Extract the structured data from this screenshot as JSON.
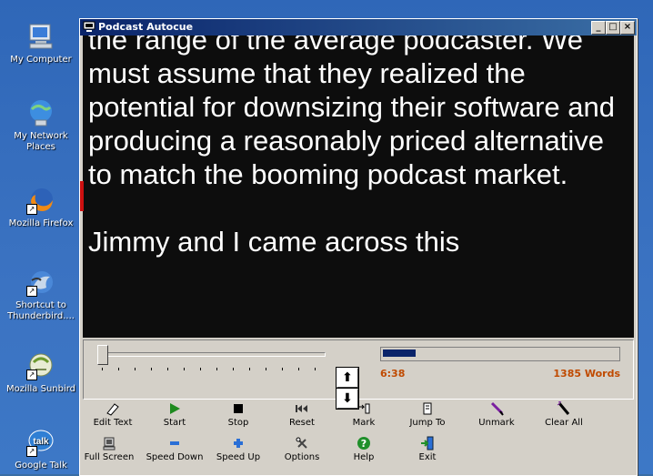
{
  "desktop": {
    "icons": [
      {
        "label": "My Computer",
        "icon": "my-computer-icon"
      },
      {
        "label": "My Network Places",
        "icon": "network-places-icon"
      },
      {
        "label": "Mozilla Firefox",
        "icon": "firefox-icon"
      },
      {
        "label": "Shortcut to Thunderbird....",
        "icon": "thunderbird-icon"
      },
      {
        "label": "Mozilla Sunbird",
        "icon": "sunbird-icon"
      },
      {
        "label": "Google Talk",
        "icon": "google-talk-icon",
        "badge": "talk"
      }
    ]
  },
  "window": {
    "title": "Podcast Autocue",
    "minimize": "_",
    "maximize": "□",
    "close": "×"
  },
  "cue": {
    "paragraph1": "the range of the average podcaster. We must assume that they realized the potential for downsizing their software and producing a reasonably priced alternative to match the booming podcast market.",
    "paragraph2": "Jimmy and I came across this"
  },
  "controls": {
    "scroll_up": "⬆",
    "scroll_down": "⬇",
    "elapsed_time": "6:38",
    "word_count": "1385 Words",
    "progress_fraction": 0.14
  },
  "toolbar": {
    "row1": [
      {
        "label": "Edit Text",
        "icon": "edit-text-icon"
      },
      {
        "label": "Start",
        "icon": "play-icon"
      },
      {
        "label": "Stop",
        "icon": "stop-icon"
      },
      {
        "label": "Reset",
        "icon": "rewind-icon"
      },
      {
        "label": "Mark",
        "icon": "mark-icon"
      },
      {
        "label": "Jump To",
        "icon": "jump-to-icon"
      },
      {
        "label": "Unmark",
        "icon": "unmark-icon"
      },
      {
        "label": "Clear All",
        "icon": "clear-all-icon"
      }
    ],
    "row2": [
      {
        "label": "Full Screen",
        "icon": "full-screen-icon"
      },
      {
        "label": "Speed Down",
        "icon": "minus-icon"
      },
      {
        "label": "Speed Up",
        "icon": "plus-icon"
      },
      {
        "label": "Options",
        "icon": "options-icon"
      },
      {
        "label": "Help",
        "icon": "help-icon"
      },
      {
        "label": "Exit",
        "icon": "exit-icon"
      }
    ]
  },
  "colors": {
    "title_bar": "#0a246a",
    "cue_background": "#0d0d0d",
    "status_text": "#c04a00",
    "marker": "#cc1010"
  }
}
